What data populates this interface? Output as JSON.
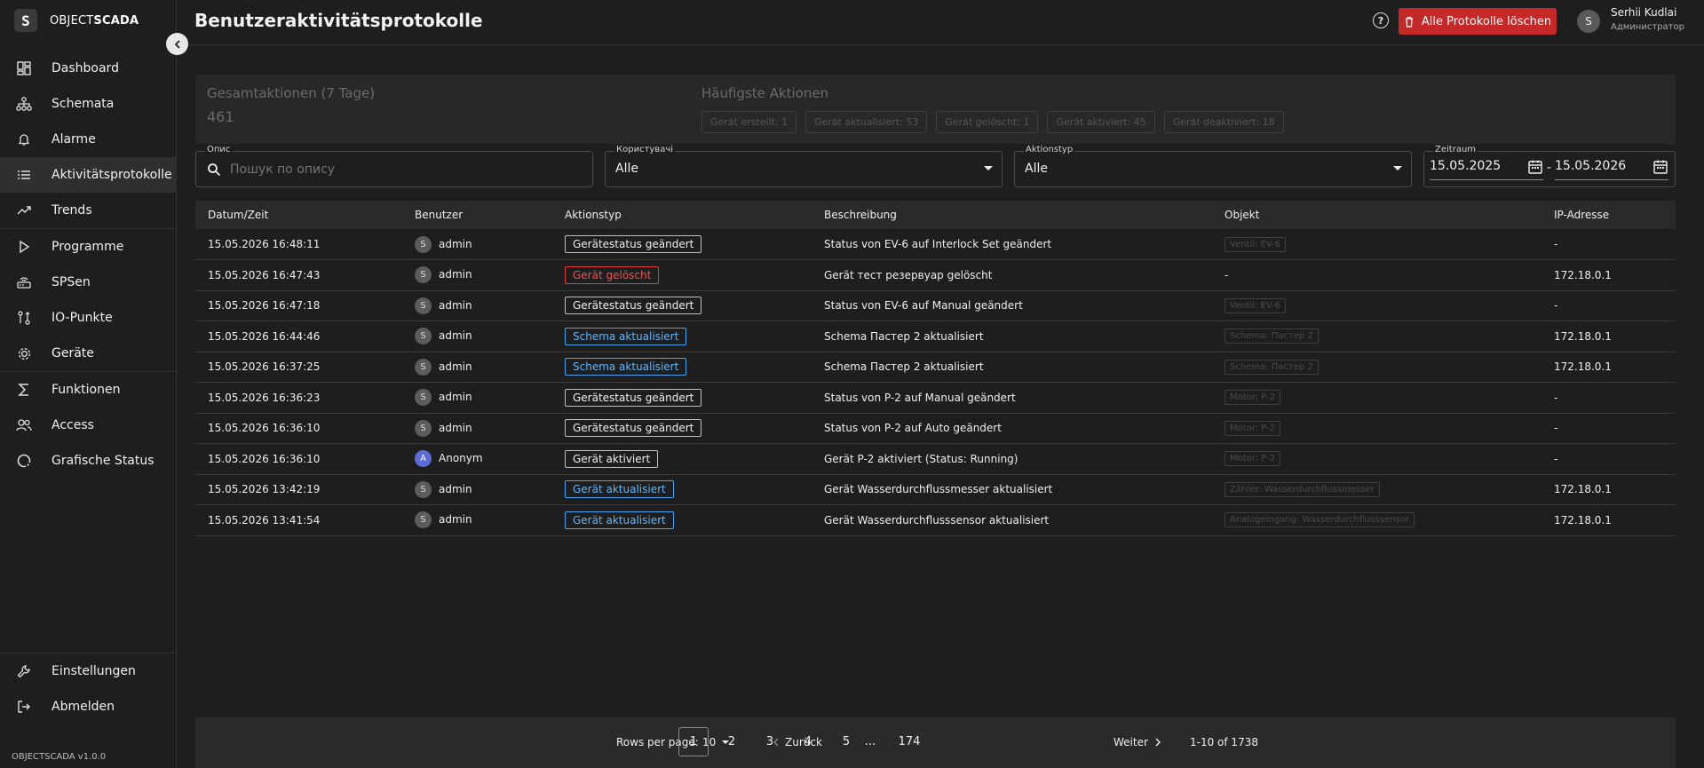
{
  "app": {
    "logo_mark": "S",
    "logo_text_light": "OBJECT",
    "logo_text_bold": "SCADA",
    "version": "OBJECTSCADA v1.0.0"
  },
  "sidebar": {
    "items": [
      {
        "label": "Dashboard",
        "icon": "dashboard-icon"
      },
      {
        "label": "Schemata",
        "icon": "sitemap-icon"
      },
      {
        "label": "Alarme",
        "icon": "bell-icon"
      },
      {
        "label": "Aktivitätsprotokolle",
        "icon": "list-icon"
      },
      {
        "label": "Trends",
        "icon": "trending-up-icon"
      },
      {
        "label": "Programme",
        "icon": "play-icon"
      },
      {
        "label": "SPSen",
        "icon": "router-icon"
      },
      {
        "label": "IO-Punkte",
        "icon": "io-points-icon"
      },
      {
        "label": "Geräte",
        "icon": "gear-icon"
      },
      {
        "label": "Funktionen",
        "icon": "sigma-icon"
      },
      {
        "label": "Access",
        "icon": "users-icon"
      },
      {
        "label": "Grafische Status",
        "icon": "circle-status-icon"
      }
    ],
    "bottom": [
      {
        "label": "Einstellungen",
        "icon": "wrench-icon"
      },
      {
        "label": "Abmelden",
        "icon": "logout-icon"
      }
    ]
  },
  "header": {
    "title": "Benutzeraktivitätsprotokolle",
    "delete_label": "Alle Protokolle löschen",
    "user_initial": "S",
    "user_name": "Serhii Kudlai",
    "user_role": "Администратор"
  },
  "stats": {
    "total_label": "Gesamtaktionen (7 Tage)",
    "total_value": "461",
    "top_label": "Häufigste Aktionen",
    "chips": [
      "Gerät erstellt: 1",
      "Gerät aktualisiert: 53",
      "Gerät gelöscht: 1",
      "Gerät aktiviert: 45",
      "Gerät deaktiviert: 18"
    ]
  },
  "filters": {
    "description_label": "Опис",
    "description_placeholder": "Пошук по опису",
    "users_label": "Користувачі",
    "users_value": "Alle",
    "action_label": "Aktionstyp",
    "action_value": "Alle",
    "period_label": "Zeitraum",
    "date_from": "15.05.2025",
    "date_sep": "-",
    "date_to": "15.05.2026"
  },
  "table": {
    "headers": [
      "Datum/Zeit",
      "Benutzer",
      "Aktionstyp",
      "Beschreibung",
      "Objekt",
      "IP-Adresse"
    ],
    "rows": [
      {
        "time": "15.05.2026 16:48:11",
        "initial": "S",
        "user": "admin",
        "action": "Gerätestatus geändert",
        "tone": "plain",
        "desc": "Status von EV-6 auf Interlock Set geändert",
        "object": "Ventil: EV-6",
        "ip": "-"
      },
      {
        "time": "15.05.2026 16:47:43",
        "initial": "S",
        "user": "admin",
        "action": "Gerät gelöscht",
        "tone": "red",
        "desc": "Gerät тест резервуар gelöscht",
        "object": "-",
        "ip": "172.18.0.1"
      },
      {
        "time": "15.05.2026 16:47:18",
        "initial": "S",
        "user": "admin",
        "action": "Gerätestatus geändert",
        "tone": "plain",
        "desc": "Status von EV-6 auf Manual geändert",
        "object": "Ventil: EV-6",
        "ip": "-"
      },
      {
        "time": "15.05.2026 16:44:46",
        "initial": "S",
        "user": "admin",
        "action": "Schema aktualisiert",
        "tone": "blue",
        "desc": "Schema Пастер 2 aktualisiert",
        "object": "Schema: Пастер 2",
        "ip": "172.18.0.1"
      },
      {
        "time": "15.05.2026 16:37:25",
        "initial": "S",
        "user": "admin",
        "action": "Schema aktualisiert",
        "tone": "blue",
        "desc": "Schema Пастер 2 aktualisiert",
        "object": "Schema: Пастер 2",
        "ip": "172.18.0.1"
      },
      {
        "time": "15.05.2026 16:36:23",
        "initial": "S",
        "user": "admin",
        "action": "Gerätestatus geändert",
        "tone": "plain",
        "desc": "Status von P-2 auf Manual geändert",
        "object": "Motor: P-2",
        "ip": "-"
      },
      {
        "time": "15.05.2026 16:36:10",
        "initial": "S",
        "user": "admin",
        "action": "Gerätestatus geändert",
        "tone": "plain",
        "desc": "Status von P-2 auf Auto geändert",
        "object": "Motor: P-2",
        "ip": "-"
      },
      {
        "time": "15.05.2026 16:36:10",
        "initial": "A",
        "user": "Anonym",
        "action": "Gerät aktiviert",
        "tone": "plain",
        "desc": "Gerät P-2 aktiviert (Status: Running)",
        "object": "Motor: P-2",
        "ip": "-"
      },
      {
        "time": "15.05.2026 13:42:19",
        "initial": "S",
        "user": "admin",
        "action": "Gerät aktualisiert",
        "tone": "blue",
        "desc": "Gerät Wasserdurchflussmesser aktualisiert",
        "object": "Zähler: Wasserdurchflussmesser",
        "ip": "172.18.0.1"
      },
      {
        "time": "15.05.2026 13:41:54",
        "initial": "S",
        "user": "admin",
        "action": "Gerät aktualisiert",
        "tone": "blue",
        "desc": "Gerät Wasserdurchflusssensor aktualisiert",
        "object": "Analogeingang: Wasserdurchflusssensor",
        "ip": "172.18.0.1"
      }
    ]
  },
  "pagination": {
    "rows_label": "Rows per page:",
    "rows_value": "10",
    "prev_label": "Zurück",
    "pages": [
      "1",
      "2",
      "3",
      "4",
      "5",
      "...",
      "174"
    ],
    "current_page": "1",
    "next_label": "Weiter",
    "range": "1-10 of 1738"
  }
}
